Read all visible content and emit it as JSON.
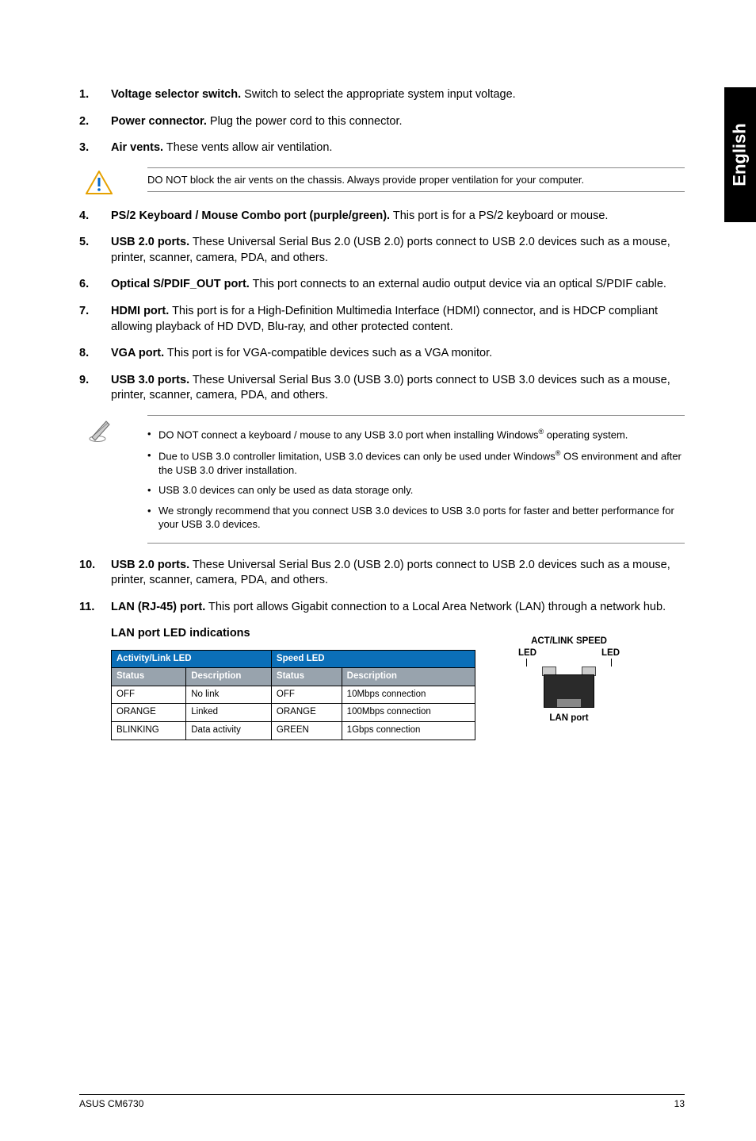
{
  "sideTab": "English",
  "items": [
    {
      "num": "1.",
      "title": "Voltage selector switch.",
      "body": "Switch to select the appropriate system input voltage."
    },
    {
      "num": "2.",
      "title": "Power connector.",
      "body": "Plug the power cord to this connector."
    },
    {
      "num": "3.",
      "title": "Air vents.",
      "body": "These vents allow air ventilation."
    }
  ],
  "warning1": "DO NOT block the air vents on the chassis. Always provide proper ventilation for your computer.",
  "items2": [
    {
      "num": "4.",
      "title": "PS/2 Keyboard / Mouse Combo port (purple/green).",
      "body": "This port is for a PS/2 keyboard or mouse."
    },
    {
      "num": "5.",
      "title": "USB 2.0 ports.",
      "body": "These Universal Serial Bus 2.0 (USB 2.0) ports connect to USB 2.0 devices such as a mouse, printer, scanner, camera, PDA, and others."
    },
    {
      "num": "6.",
      "title": "Optical S/PDIF_OUT port.",
      "body": "This port connects to an external audio output device via an optical S/PDIF cable."
    },
    {
      "num": "7.",
      "title": "HDMI port.",
      "body": "This port is for a High-Definition Multimedia Interface (HDMI) connector, and is HDCP compliant allowing playback of HD DVD, Blu-ray, and other protected content."
    },
    {
      "num": "8.",
      "title": "VGA port.",
      "body": "This port is for VGA-compatible devices such as a VGA monitor."
    },
    {
      "num": "9.",
      "title": "USB 3.0 ports.",
      "body": "These Universal Serial Bus 3.0 (USB 3.0) ports connect to USB 3.0 devices such as a mouse, printer, scanner, camera, PDA, and others."
    }
  ],
  "notes": {
    "b1a": "DO NOT connect a keyboard / mouse to any USB 3.0 port when installing Windows",
    "b1b": " operating system.",
    "b2a": "Due to USB 3.0 controller limitation, USB 3.0 devices can only be used under Windows",
    "b2b": " OS environment and after the USB 3.0 driver installation.",
    "b3": "USB 3.0 devices can only be used as data storage only.",
    "b4": "We strongly recommend that you connect USB 3.0 devices to USB 3.0 ports for faster and better performance for your USB 3.0 devices."
  },
  "items3": [
    {
      "num": "10.",
      "title": "USB 2.0 ports.",
      "body": "These Universal Serial Bus 2.0 (USB 2.0) ports connect to USB 2.0 devices such as a mouse, printer, scanner, camera, PDA, and others."
    },
    {
      "num": "11.",
      "title": "LAN (RJ-45) port.",
      "body": "This port allows Gigabit connection to a Local Area Network (LAN) through a network hub."
    }
  ],
  "subheading": "LAN port LED indications",
  "table": {
    "h1": "Activity/Link LED",
    "h2": "Speed LED",
    "c1": "Status",
    "c2": "Description",
    "c3": "Status",
    "c4": "Description",
    "rows": [
      [
        "OFF",
        "No link",
        "OFF",
        "10Mbps connection"
      ],
      [
        "ORANGE",
        "Linked",
        "ORANGE",
        "100Mbps connection"
      ],
      [
        "BLINKING",
        "Data activity",
        "GREEN",
        "1Gbps connection"
      ]
    ]
  },
  "diagram": {
    "top1": "ACT/LINK",
    "top2": "SPEED",
    "led": "LED",
    "bottom": "LAN port"
  },
  "footer": {
    "left": "ASUS CM6730",
    "right": "13"
  }
}
